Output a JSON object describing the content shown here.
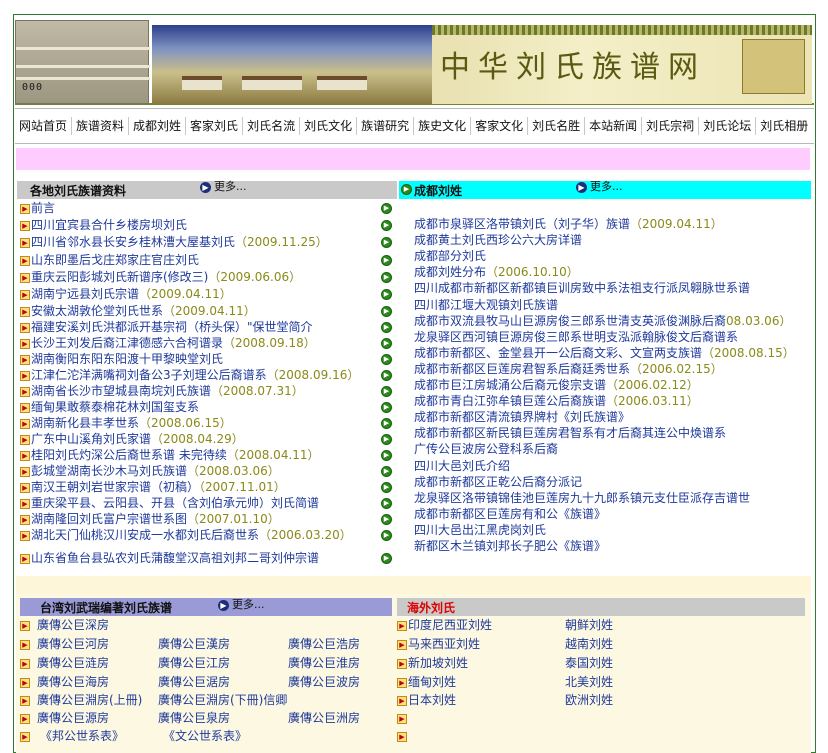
{
  "header": {
    "site_title": "中华刘氏族谱网",
    "logo_dots": "000"
  },
  "nav": [
    "网站首页",
    "族谱资料",
    "成都刘姓",
    "客家刘氏",
    "刘氏名流",
    "刘氏文化",
    "族谱研究",
    "族史文化",
    "客家文化",
    "刘氏名胜",
    "本站新闻",
    "刘氏宗祠",
    "刘氏论坛",
    "刘氏相册"
  ],
  "left_section": {
    "title": "各地刘氏族谱资料",
    "more": "更多...",
    "items": [
      {
        "text": "前言",
        "date": ""
      },
      {
        "text": "四川宜宾县合什乡楼房坝刘氏",
        "date": ""
      },
      {
        "text": "四川省邻水县长安乡桂林漕大屋基刘氏",
        "date": "（2009.11.25）"
      },
      {
        "text": "山东即墨后戈庄郑家庄官庄刘氏",
        "date": ""
      },
      {
        "text": "重庆云阳彭城刘氏新谱序(修改三)",
        "date": "（2009.06.06）"
      },
      {
        "text": "湖南宁远县刘氏宗谱",
        "date": "（2009.04.11）"
      },
      {
        "text": "安徽太湖敦伦堂刘氏世系",
        "date": "（2009.04.11）"
      },
      {
        "text": "福建安溪刘氏洪都派开基宗祠（桥头保）\"保世堂简介",
        "date": ""
      },
      {
        "text": "长沙王刘发后裔江津德感六合柯谱录",
        "date": "（2008.09.18）"
      },
      {
        "text": "湖南衡阳东阳东阳渡十甲黎映堂刘氏",
        "date": ""
      },
      {
        "text": "江津仁沱洋满嘴祠刘备公3子刘理公后裔谱系",
        "date": "（2008.09.16）"
      },
      {
        "text": "湖南省长沙市望城县南垸刘氏族谱",
        "date": "（2008.07.31）"
      },
      {
        "text": "缅甸果敢蔡泰棉花林刘国玺支系",
        "date": ""
      },
      {
        "text": "湖南新化县丰孝世系",
        "date": "（2008.06.15）"
      },
      {
        "text": "广东中山溪角刘氏家谱",
        "date": "（2008.04.29）"
      },
      {
        "text": "桂阳刘氏灼深公后裔世系谱 未完待续",
        "date": "（2008.04.11）"
      },
      {
        "text": "彭城堂湖南长沙木马刘氏族谱",
        "date": "（2008.03.06）"
      },
      {
        "text": "南汉王朝刘岩世家宗谱（初稿）",
        "date": "（2007.11.01）"
      },
      {
        "text": "重庆梁平县、云阳县、开县（含刘伯承元帅）刘氏简谱",
        "date": ""
      },
      {
        "text": "湖南隆回刘氏富户宗谱世系图",
        "date": "（2007.01.10）"
      },
      {
        "text": "湖北天门仙桃汉川安成一水都刘氏后裔世系",
        "date": "（2006.03.20）"
      },
      {
        "text": "山东省鱼台县弘农刘氏蒲馥堂汉高祖刘邦二哥刘仲宗谱",
        "date": ""
      }
    ]
  },
  "right_section": {
    "title": "成都刘姓",
    "more": "更多...",
    "items": [
      {
        "text": "成都市泉驿区洛带镇刘氏（刘子华）族谱",
        "date": "（2009.04.11）"
      },
      {
        "text": "成都黄土刘氏西珍公六大房详谱",
        "date": ""
      },
      {
        "text": "成都部分刘氏",
        "date": ""
      },
      {
        "text": "成都刘姓分布",
        "date": "（2006.10.10）"
      },
      {
        "text": "四川成都市新都区新都镇巨训房致中系法祖支行派凤翱脉世系谱",
        "date": ""
      },
      {
        "text": "四川都江堰大观镇刘氏族谱",
        "date": ""
      },
      {
        "text": "成都市双流县牧马山巨源房俊三郎系世清支英派俊渊脉后裔",
        "date": "08.03.06）"
      },
      {
        "text": "龙泉驿区西河镇巨源房俊三郎系世明支泓派翰脉俊文后裔谱系",
        "date": ""
      },
      {
        "text": "成都市新都区、金堂县开一公后裔文彩、文宣两支族谱",
        "date": "（2008.08.15）"
      },
      {
        "text": "成都市新都区巨莲房君智系后裔廷秀世系",
        "date": "（2006.02.15）"
      },
      {
        "text": "成都市巨江房城涌公后裔元俊宗支谱",
        "date": "（2006.02.12）"
      },
      {
        "text": "成都市青白江弥牟镇巨莲公后裔族谱",
        "date": "（2006.03.11）"
      },
      {
        "text": "成都市新都区清流镇界牌村《刘氏族谱》",
        "date": ""
      },
      {
        "text": "成都市新都区新民镇巨莲房君智系有才后裔其连公中焕谱系",
        "date": ""
      },
      {
        "text": "广传公巨波房公登科系后裔",
        "date": ""
      },
      {
        "text": "四川大邑刘氏介绍",
        "date": ""
      },
      {
        "text": "成都市新都区正乾公后裔分派记",
        "date": ""
      },
      {
        "text": "龙泉驿区洛带镇锦佳池巨莲房九十九郎系镇元支仕臣派存吉谱世",
        "date": ""
      },
      {
        "text": "成都市新都区巨莲房有和公《族谱》",
        "date": ""
      },
      {
        "text": "四川大邑出江黑虎岗刘氏",
        "date": ""
      },
      {
        "text": "新都区木兰镇刘邦长子肥公《族谱》",
        "date": ""
      }
    ]
  },
  "taiwan_section": {
    "title": "台湾刘武瑞编著刘氏族谱",
    "more": "更多...",
    "rows": [
      [
        "廣傳公巨深房",
        "",
        ""
      ],
      [
        "廣傳公巨河房",
        "廣傳公巨漢房",
        "廣傳公巨浩房"
      ],
      [
        "廣傳公巨涟房",
        "廣傳公巨江房",
        "廣傳公巨淮房"
      ],
      [
        "廣傳公巨海房",
        "廣傳公巨涺房",
        "廣傳公巨波房"
      ],
      [
        "廣傳公巨淵房(上冊)",
        "廣傳公巨淵房(下冊)信卿",
        ""
      ],
      [
        "廣傳公巨源房",
        "廣傳公巨泉房",
        "廣傳公巨洲房"
      ],
      [
        "《邦公世系表》",
        "《文公世系表》",
        ""
      ]
    ]
  },
  "overseas_section": {
    "title": "海外刘氏",
    "rows": [
      [
        "印度尼西亚刘姓",
        "朝鲜刘姓"
      ],
      [
        "马来西亚刘姓",
        "越南刘姓"
      ],
      [
        "新加坡刘姓",
        "泰国刘姓"
      ],
      [
        "缅甸刘姓",
        "北美刘姓"
      ],
      [
        "日本刘姓",
        "欧洲刘姓"
      ],
      [
        "",
        ""
      ],
      [
        "",
        ""
      ]
    ]
  }
}
